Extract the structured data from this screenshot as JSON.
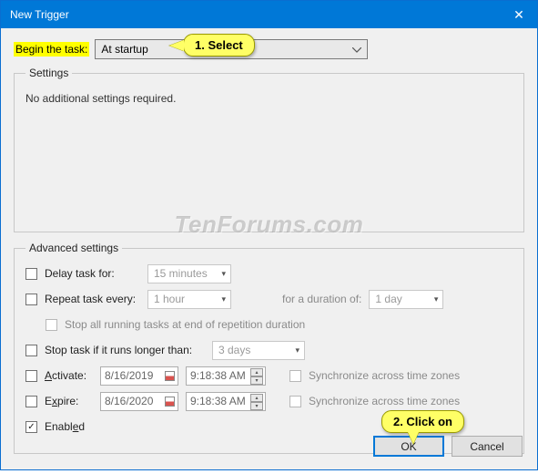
{
  "window": {
    "title": "New Trigger"
  },
  "beginTask": {
    "label": "Begin the task:",
    "value": "At startup"
  },
  "settings": {
    "legend": "Settings",
    "body": "No additional settings required."
  },
  "advanced": {
    "legend": "Advanced settings",
    "delay": {
      "label": "Delay task for:",
      "value": "15 minutes"
    },
    "repeat": {
      "label": "Repeat task every:",
      "value": "1 hour",
      "durationLabel": "for a duration of:",
      "durationValue": "1 day"
    },
    "stopRunning": {
      "label": "Stop all running tasks at end of repetition duration"
    },
    "stopLonger": {
      "label": "Stop task if it runs longer than:",
      "value": "3 days"
    },
    "activate": {
      "label": "Activate:",
      "date": "8/16/2019",
      "time": "9:18:38 AM",
      "sync": "Synchronize across time zones"
    },
    "expire": {
      "label": "Expire:",
      "date": "8/16/2020",
      "time": "9:18:38 AM",
      "sync": "Synchronize across time zones"
    },
    "enabled": {
      "label": "Enabled",
      "checked": true
    }
  },
  "buttons": {
    "ok": "OK",
    "cancel": "Cancel"
  },
  "callouts": {
    "c1": "1. Select",
    "c2": "2. Click on"
  },
  "watermark": "TenForums.com"
}
